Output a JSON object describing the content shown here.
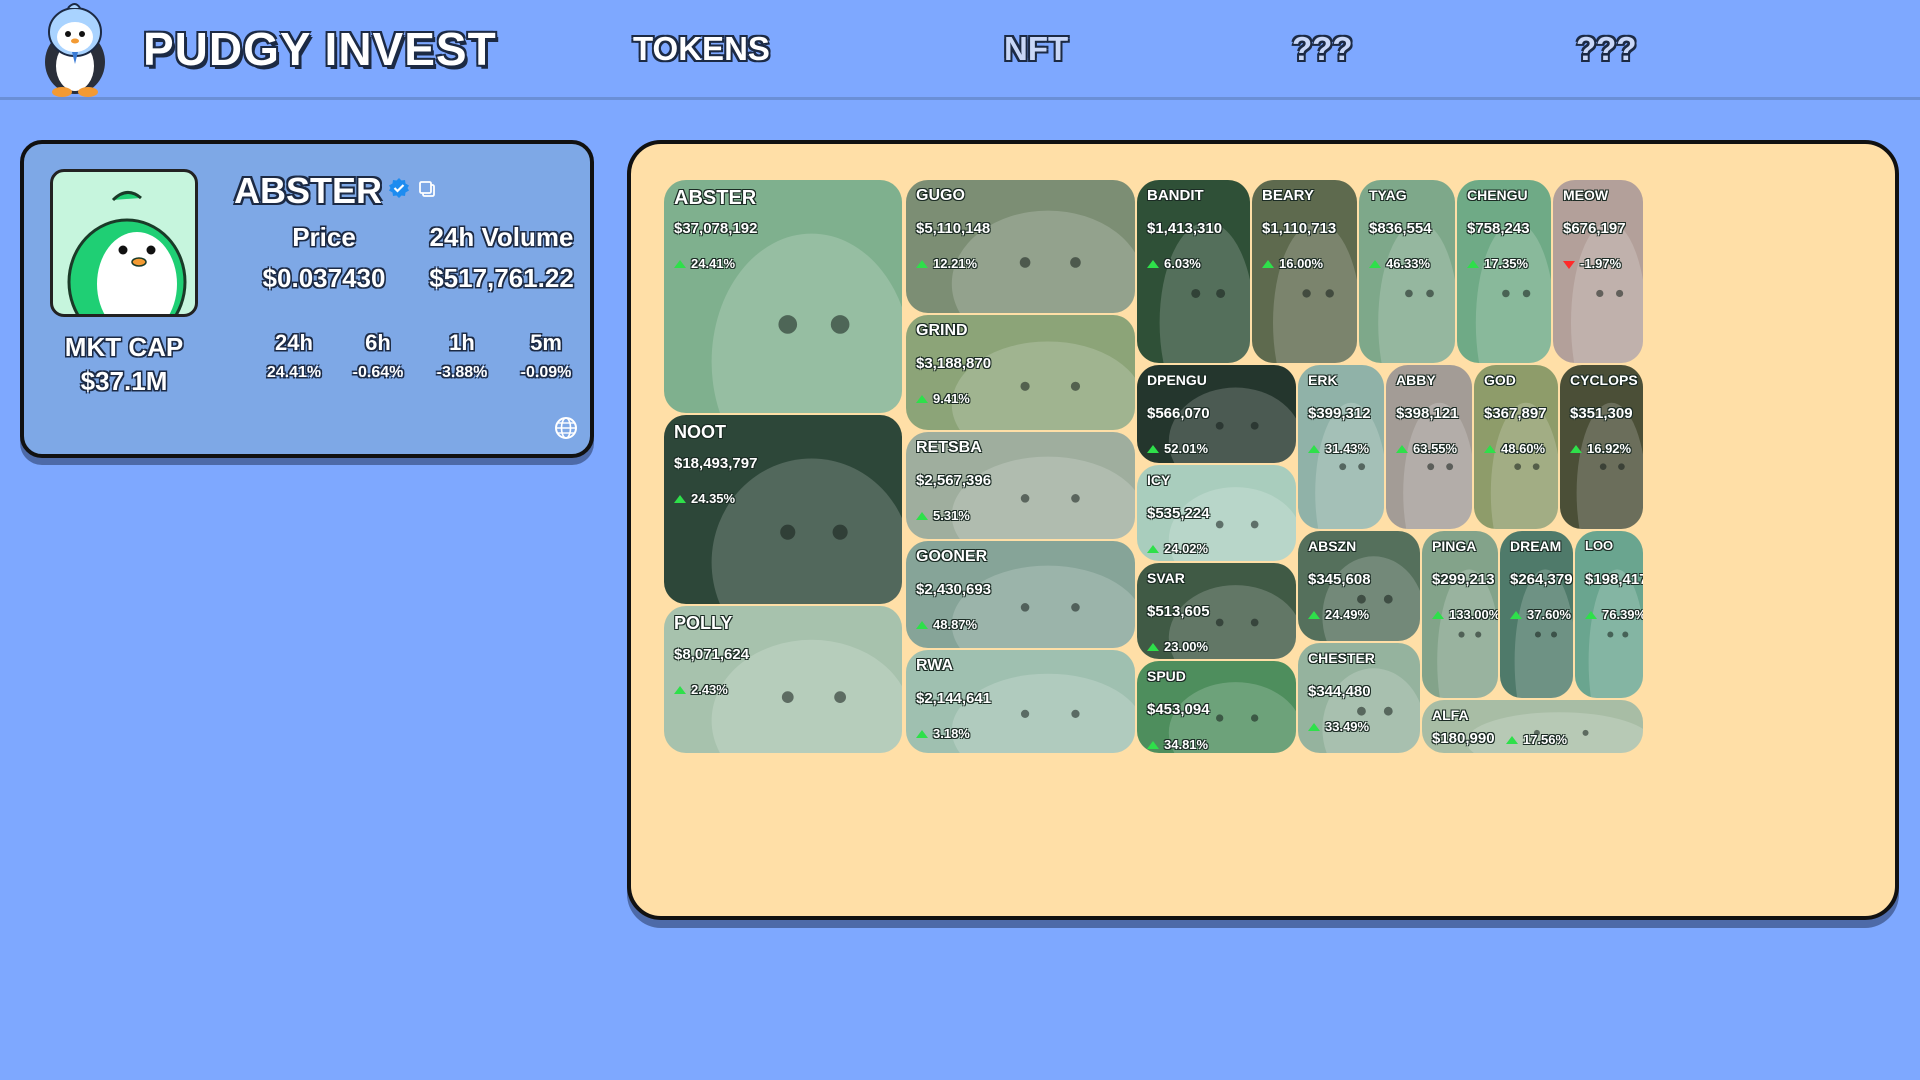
{
  "header": {
    "brand": "PUDGY INVEST",
    "nav": [
      "TOKENS",
      "NFT",
      "???",
      "???"
    ]
  },
  "token": {
    "name": "ABSTER",
    "mkt_cap_label": "MKT CAP",
    "mkt_cap": "$37.1M",
    "price_label": "Price",
    "price": "$0.037430",
    "volume_label": "24h Volume",
    "volume": "$517,761.22",
    "changes": [
      {
        "label": "24h",
        "value": "24.41%"
      },
      {
        "label": "6h",
        "value": "-0.64%"
      },
      {
        "label": "1h",
        "value": "-3.88%"
      },
      {
        "label": "5m",
        "value": "-0.09%"
      }
    ]
  },
  "tiles": [
    {
      "name": "ABSTER",
      "mcap": "$37,078,192",
      "change": "24.41%",
      "dir": "up",
      "color": "#7fb08e"
    },
    {
      "name": "NOOT",
      "mcap": "$18,493,797",
      "change": "24.35%",
      "dir": "up",
      "color": "#2d4739"
    },
    {
      "name": "POLLY",
      "mcap": "$8,071,624",
      "change": "2.43%",
      "dir": "up",
      "color": "#a7c2ad"
    },
    {
      "name": "GUGO",
      "mcap": "$5,110,148",
      "change": "12.21%",
      "dir": "up",
      "color": "#7c8e74"
    },
    {
      "name": "GRIND",
      "mcap": "$3,188,870",
      "change": "9.41%",
      "dir": "up",
      "color": "#8ca478"
    },
    {
      "name": "RETSBA",
      "mcap": "$2,567,396",
      "change": "5.31%",
      "dir": "up",
      "color": "#9fae9e"
    },
    {
      "name": "GOONER",
      "mcap": "$2,430,693",
      "change": "48.87%",
      "dir": "up",
      "color": "#86a498"
    },
    {
      "name": "RWA",
      "mcap": "$2,144,641",
      "change": "3.18%",
      "dir": "up",
      "color": "#9fc0b0"
    },
    {
      "name": "BANDIT",
      "mcap": "$1,413,310",
      "change": "6.03%",
      "dir": "up",
      "color": "#2f5037"
    },
    {
      "name": "BEARY",
      "mcap": "$1,110,713",
      "change": "16.00%",
      "dir": "up",
      "color": "#5e6a4e"
    },
    {
      "name": "TYAG",
      "mcap": "$836,554",
      "change": "46.33%",
      "dir": "up",
      "color": "#7ea88a"
    },
    {
      "name": "CHENGU",
      "mcap": "$758,243",
      "change": "17.35%",
      "dir": "up",
      "color": "#6faa86"
    },
    {
      "name": "MEOW",
      "mcap": "$676,197",
      "change": "-1.97%",
      "dir": "down",
      "color": "#b3a09a"
    },
    {
      "name": "DPENGU",
      "mcap": "$566,070",
      "change": "52.01%",
      "dir": "up",
      "color": "#24362d"
    },
    {
      "name": "ICY",
      "mcap": "$535,224",
      "change": "24.02%",
      "dir": "up",
      "color": "#a9cdbd"
    },
    {
      "name": "SVAR",
      "mcap": "$513,605",
      "change": "23.00%",
      "dir": "up",
      "color": "#405a45"
    },
    {
      "name": "SPUD",
      "mcap": "$453,094",
      "change": "34.81%",
      "dir": "up",
      "color": "#4e8e5d"
    },
    {
      "name": "ERK",
      "mcap": "$399,312",
      "change": "31.43%",
      "dir": "up",
      "color": "#90b2a8"
    },
    {
      "name": "ABBY",
      "mcap": "$398,121",
      "change": "63.55%",
      "dir": "up",
      "color": "#a39c96"
    },
    {
      "name": "GOD",
      "mcap": "$367,897",
      "change": "48.60%",
      "dir": "up",
      "color": "#8e9c6a"
    },
    {
      "name": "CYCLOPS",
      "mcap": "$351,309",
      "change": "16.92%",
      "dir": "up",
      "color": "#4b4f37"
    },
    {
      "name": "ABSZN",
      "mcap": "$345,608",
      "change": "24.49%",
      "dir": "up",
      "color": "#55705c"
    },
    {
      "name": "CHESTER",
      "mcap": "$344,480",
      "change": "33.49%",
      "dir": "up",
      "color": "#95b39e"
    },
    {
      "name": "PINGA",
      "mcap": "$299,213",
      "change": "133.00%",
      "dir": "up",
      "color": "#83a38a"
    },
    {
      "name": "DREAM",
      "mcap": "$264,379",
      "change": "37.60%",
      "dir": "up",
      "color": "#4f7a6a"
    },
    {
      "name": "LOO",
      "mcap": "$198,417",
      "change": "76.39%",
      "dir": "up",
      "color": "#6aa58f"
    },
    {
      "name": "ALFA",
      "mcap": "$180,990",
      "change": "17.56%",
      "dir": "up",
      "color": "#a8bda5"
    }
  ]
}
